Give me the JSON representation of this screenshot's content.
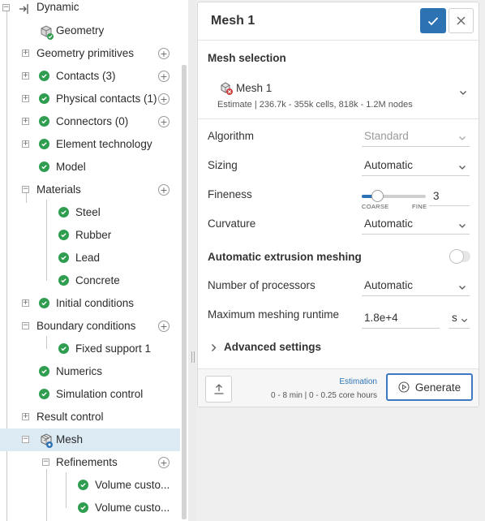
{
  "tree": {
    "items": [
      {
        "label": "Dynamic",
        "icon": "dynamic-icon"
      },
      {
        "label": "Geometry",
        "icon": "geometry-icon"
      },
      {
        "label": "Geometry primitives"
      },
      {
        "label": "Contacts (3)"
      },
      {
        "label": "Physical contacts (1)"
      },
      {
        "label": "Connectors (0)"
      },
      {
        "label": "Element technology"
      },
      {
        "label": "Model"
      },
      {
        "label": "Materials"
      },
      {
        "label": "Steel"
      },
      {
        "label": "Rubber"
      },
      {
        "label": "Lead"
      },
      {
        "label": "Concrete"
      },
      {
        "label": "Initial conditions"
      },
      {
        "label": "Boundary conditions"
      },
      {
        "label": "Fixed support 1"
      },
      {
        "label": "Numerics"
      },
      {
        "label": "Simulation control"
      },
      {
        "label": "Result control"
      },
      {
        "label": "Mesh",
        "icon": "mesh-icon",
        "selected": true
      },
      {
        "label": "Refinements"
      },
      {
        "label": "Volume custo..."
      },
      {
        "label": "Volume custo..."
      }
    ]
  },
  "dialog": {
    "title": "Mesh 1",
    "mesh_selection_label": "Mesh selection",
    "mesh_name": "Mesh 1",
    "mesh_estimate": "Estimate | 236.7k - 355k cells, 818k - 1.2M nodes",
    "fields": {
      "algorithm": {
        "label": "Algorithm",
        "value": "Standard"
      },
      "sizing": {
        "label": "Sizing",
        "value": "Automatic"
      },
      "fineness": {
        "label": "Fineness",
        "value": "3",
        "coarse": "COARSE",
        "fine": "FINE",
        "level": 0.25
      },
      "curvature": {
        "label": "Curvature",
        "value": "Automatic"
      },
      "extrusion": {
        "label": "Automatic extrusion meshing",
        "enabled": false
      },
      "processors": {
        "label": "Number of processors",
        "value": "Automatic"
      },
      "runtime": {
        "label": "Maximum meshing runtime",
        "value": "1.8e+4",
        "unit": "s"
      }
    },
    "advanced_label": "Advanced settings",
    "footer": {
      "estimation_link": "Estimation",
      "estimation_info": "0 - 8 min | 0 - 0.25 core hours",
      "generate_label": "Generate"
    }
  },
  "colors": {
    "accent": "#2d73b4",
    "check": "#2f9d4f",
    "selected_row": "#dbeaf3"
  }
}
